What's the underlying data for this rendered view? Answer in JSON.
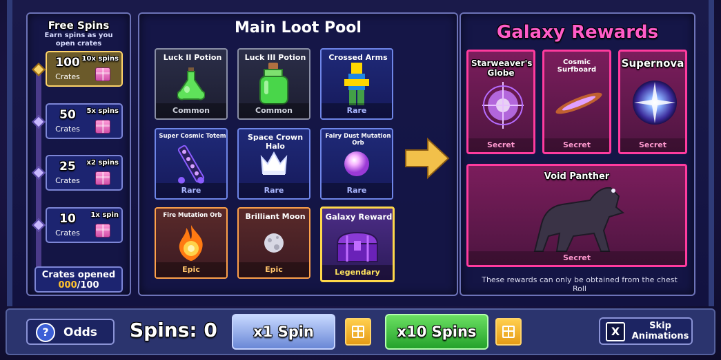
{
  "free_spins": {
    "title": "Free Spins",
    "subtitle": "Earn spins as you open crates",
    "tiers": [
      {
        "crates": "100",
        "label": "Crates",
        "spins": "10x spins"
      },
      {
        "crates": "50",
        "label": "Crates",
        "spins": "5x spins"
      },
      {
        "crates": "25",
        "label": "Crates",
        "spins": "x2 spins"
      },
      {
        "crates": "10",
        "label": "Crates",
        "spins": "1x spin"
      }
    ],
    "opened_label": "Crates opened",
    "opened_count": "000",
    "opened_total": "/100"
  },
  "loot_pool": {
    "title": "Main Loot Pool",
    "items": [
      {
        "name": "Luck II Potion",
        "rarity": "Common",
        "icon": "green-potion-icon"
      },
      {
        "name": "Luck III Potion",
        "rarity": "Common",
        "icon": "large-green-potion-icon"
      },
      {
        "name": "Crossed Arms",
        "rarity": "Rare",
        "icon": "crossed-arms-avatar-icon"
      },
      {
        "name": "Super Cosmic Totem",
        "rarity": "Rare",
        "icon": "cosmic-totem-icon"
      },
      {
        "name": "Space Crown Halo",
        "rarity": "Rare",
        "icon": "crown-halo-icon"
      },
      {
        "name": "Fairy Dust Mutation Orb",
        "rarity": "Rare",
        "icon": "pink-orb-icon"
      },
      {
        "name": "Fire Mutation Orb",
        "rarity": "Epic",
        "icon": "fire-orb-icon"
      },
      {
        "name": "Brilliant Moon",
        "rarity": "Epic",
        "icon": "moon-icon"
      },
      {
        "name": "Galaxy Reward",
        "rarity": "Legendary",
        "icon": "galaxy-chest-icon"
      }
    ]
  },
  "galaxy_rewards": {
    "title": "Galaxy Rewards",
    "items": [
      {
        "name": "Starweaver's Globe",
        "rarity": "Secret",
        "icon": "starweaver-globe-icon"
      },
      {
        "name": "Cosmic Surfboard",
        "rarity": "Secret",
        "icon": "cosmic-surfboard-icon"
      },
      {
        "name": "Supernova",
        "rarity": "Secret",
        "icon": "supernova-icon"
      },
      {
        "name": "Void Panther",
        "rarity": "Secret",
        "icon": "void-panther-icon"
      }
    ],
    "note": "These rewards can only be obtained from the chest Roll"
  },
  "bottom_bar": {
    "odds_label": "Odds",
    "odds_icon": "?",
    "spins_label": "Spins: 0",
    "x1_label": "x1 Spin",
    "x10_label": "x10 Spins",
    "skip_label": "Skip Animations",
    "skip_icon": "X"
  },
  "colors": {
    "accent_pink": "#ff5cc8",
    "gold": "#ffd84a",
    "spin_green": "#24a22b",
    "spin_blue": "#6a88d6"
  }
}
